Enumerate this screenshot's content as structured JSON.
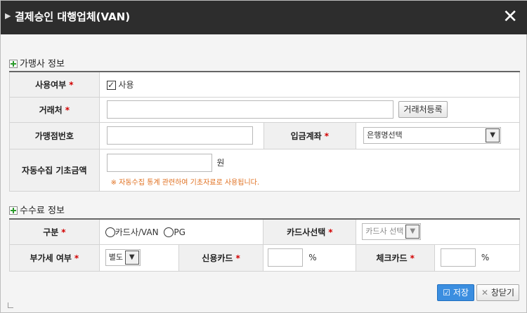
{
  "dialog": {
    "title": "결제승인 대행업체(VAN)",
    "close_glyph": "✕"
  },
  "section1": {
    "title": "가맹사 정보",
    "usage_label": "사용여부",
    "usage_checkbox_label": "사용",
    "usage_checked": true,
    "client_label": "거래처",
    "client_value": "",
    "client_register_button": "거래처등록",
    "merchant_no_label": "가맹점번호",
    "merchant_no_value": "",
    "deposit_account_label": "입금계좌",
    "bank_select_value": "은행명선택",
    "auto_collect_label": "자동수집 기초금액",
    "auto_collect_value": "",
    "currency_unit": "원",
    "auto_collect_notice": "※ 자동수집 통계 관련하여 기초자료로 사용됩니다."
  },
  "section2": {
    "title": "수수료 정보",
    "type_label": "구분",
    "type_options": [
      "카드사/VAN",
      "PG"
    ],
    "card_select_label": "카드사선택",
    "card_select_value": "카드사 선택",
    "vat_label": "부가세 여부",
    "vat_select_value": "별도",
    "credit_card_label": "신용카드",
    "credit_card_value": "",
    "check_card_label": "체크카드",
    "check_card_value": "",
    "percent_unit": "%"
  },
  "footer": {
    "save_button": "저장",
    "close_button": "창닫기"
  },
  "required_mark": "*"
}
